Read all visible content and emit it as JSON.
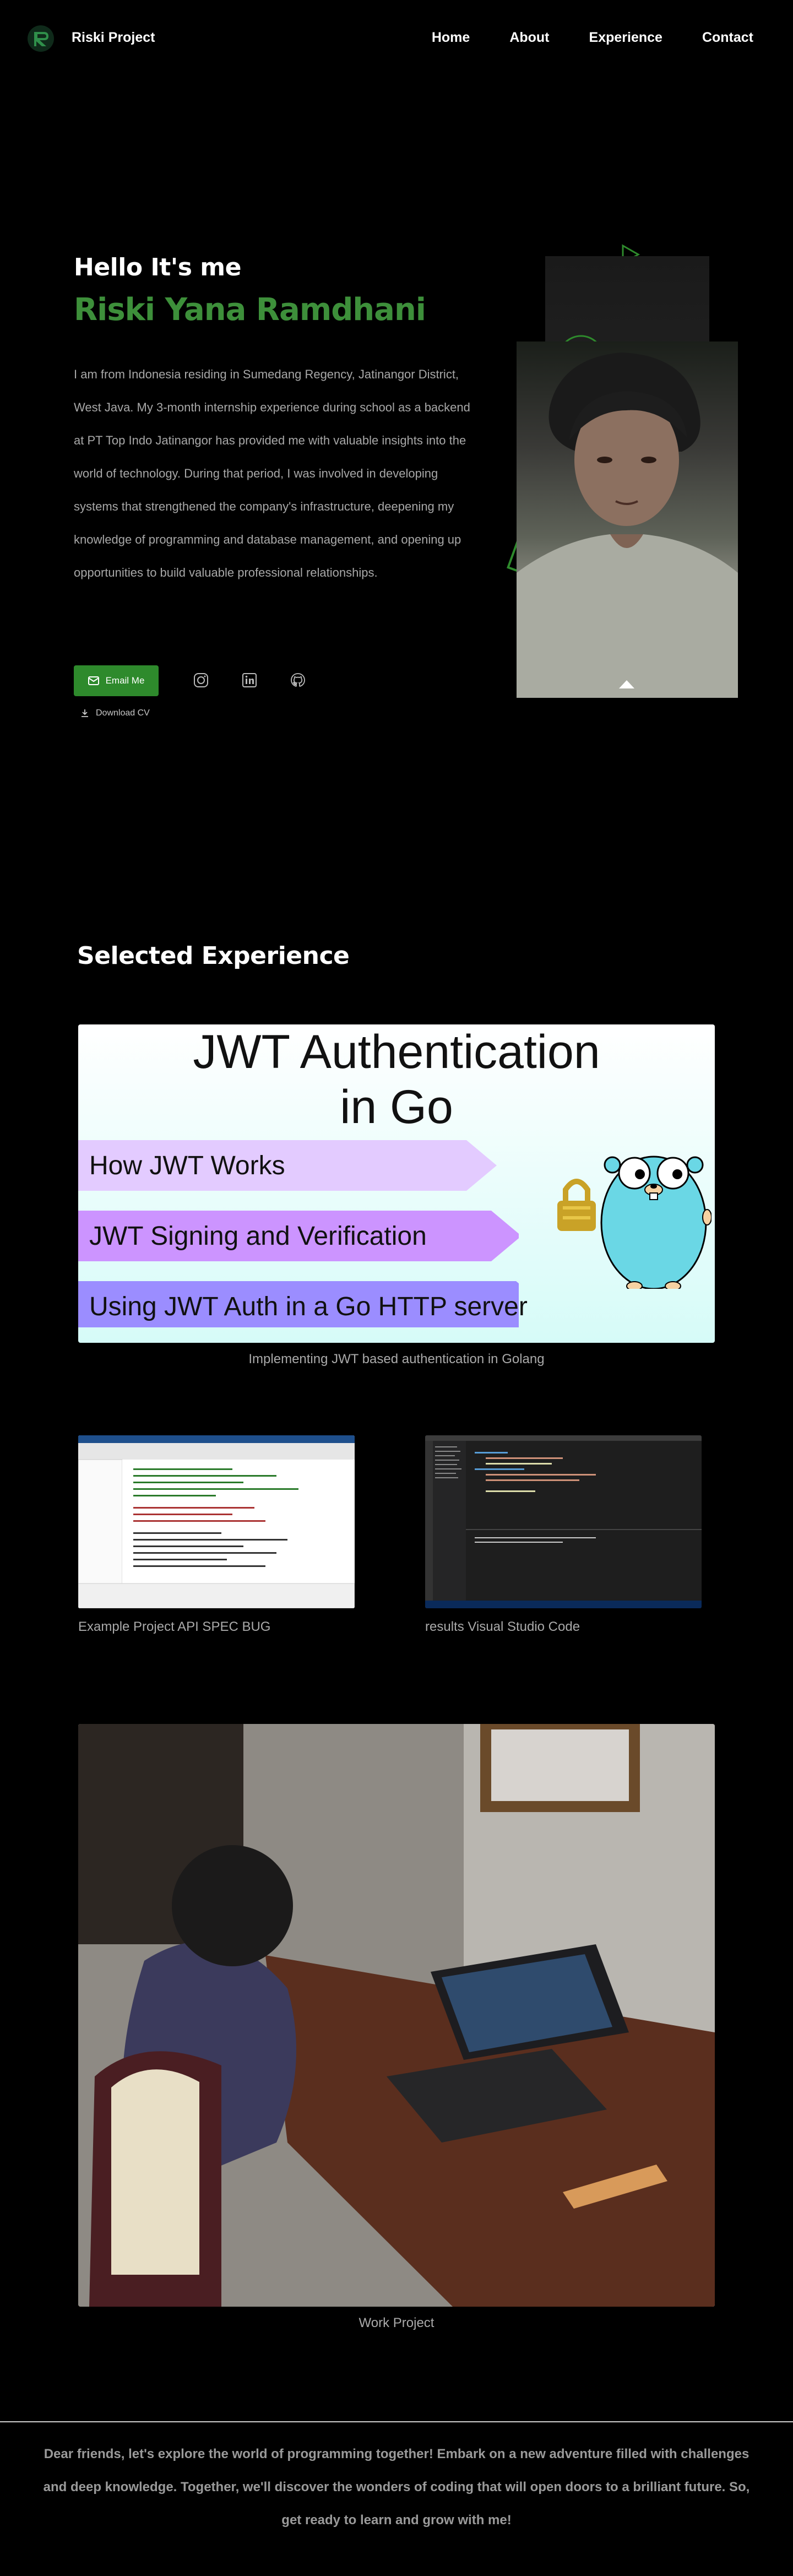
{
  "nav": {
    "brand": "Riski Project",
    "links": [
      "Home",
      "About",
      "Experience",
      "Contact"
    ]
  },
  "hero": {
    "greeting": "Hello It's me",
    "name": "Riski Yana Ramdhani",
    "bio": "I am from Indonesia residing in Sumedang Regency, Jatinangor District, West Java. My 3-month internship experience during school as a backend at PT Top Indo Jatinangor has provided me with valuable insights into the world of technology. During that period, I was involved in developing systems that strengthened the company's infrastructure, deepening my knowledge of programming and database management, and opening up opportunities to build valuable professional relationships.",
    "email_button": "Email Me",
    "download_cv": "Download CV",
    "social_icons": [
      "instagram-icon",
      "linkedin-icon",
      "github-icon"
    ]
  },
  "experience": {
    "title": "Selected Experience",
    "jwt_banner": {
      "title_line1": "JWT Authentication",
      "title_line2": "in Go",
      "rows": [
        "How JWT Works",
        "JWT Signing and Verification",
        "Using JWT Auth in a Go HTTP server"
      ],
      "row_colors": [
        "#e3cbff",
        "#cc94ff",
        "#9b8dff"
      ]
    },
    "jwt_caption": "Implementing JWT based authentication in Golang",
    "thumb1_caption": "Example Project API SPEC BUG",
    "thumb2_caption": "results Visual Studio Code",
    "work_caption": "Work Project"
  },
  "footer": {
    "text": "Dear friends, let's explore the world of programming together! Embark on a new adventure filled with challenges and deep knowledge. Together, we'll discover the wonders of coding that will open doors to a brilliant future. So, get ready to learn and grow with me!"
  },
  "colors": {
    "accent_green": "#3d8f3a",
    "button_green": "#2e8a2c",
    "background": "#000000"
  }
}
